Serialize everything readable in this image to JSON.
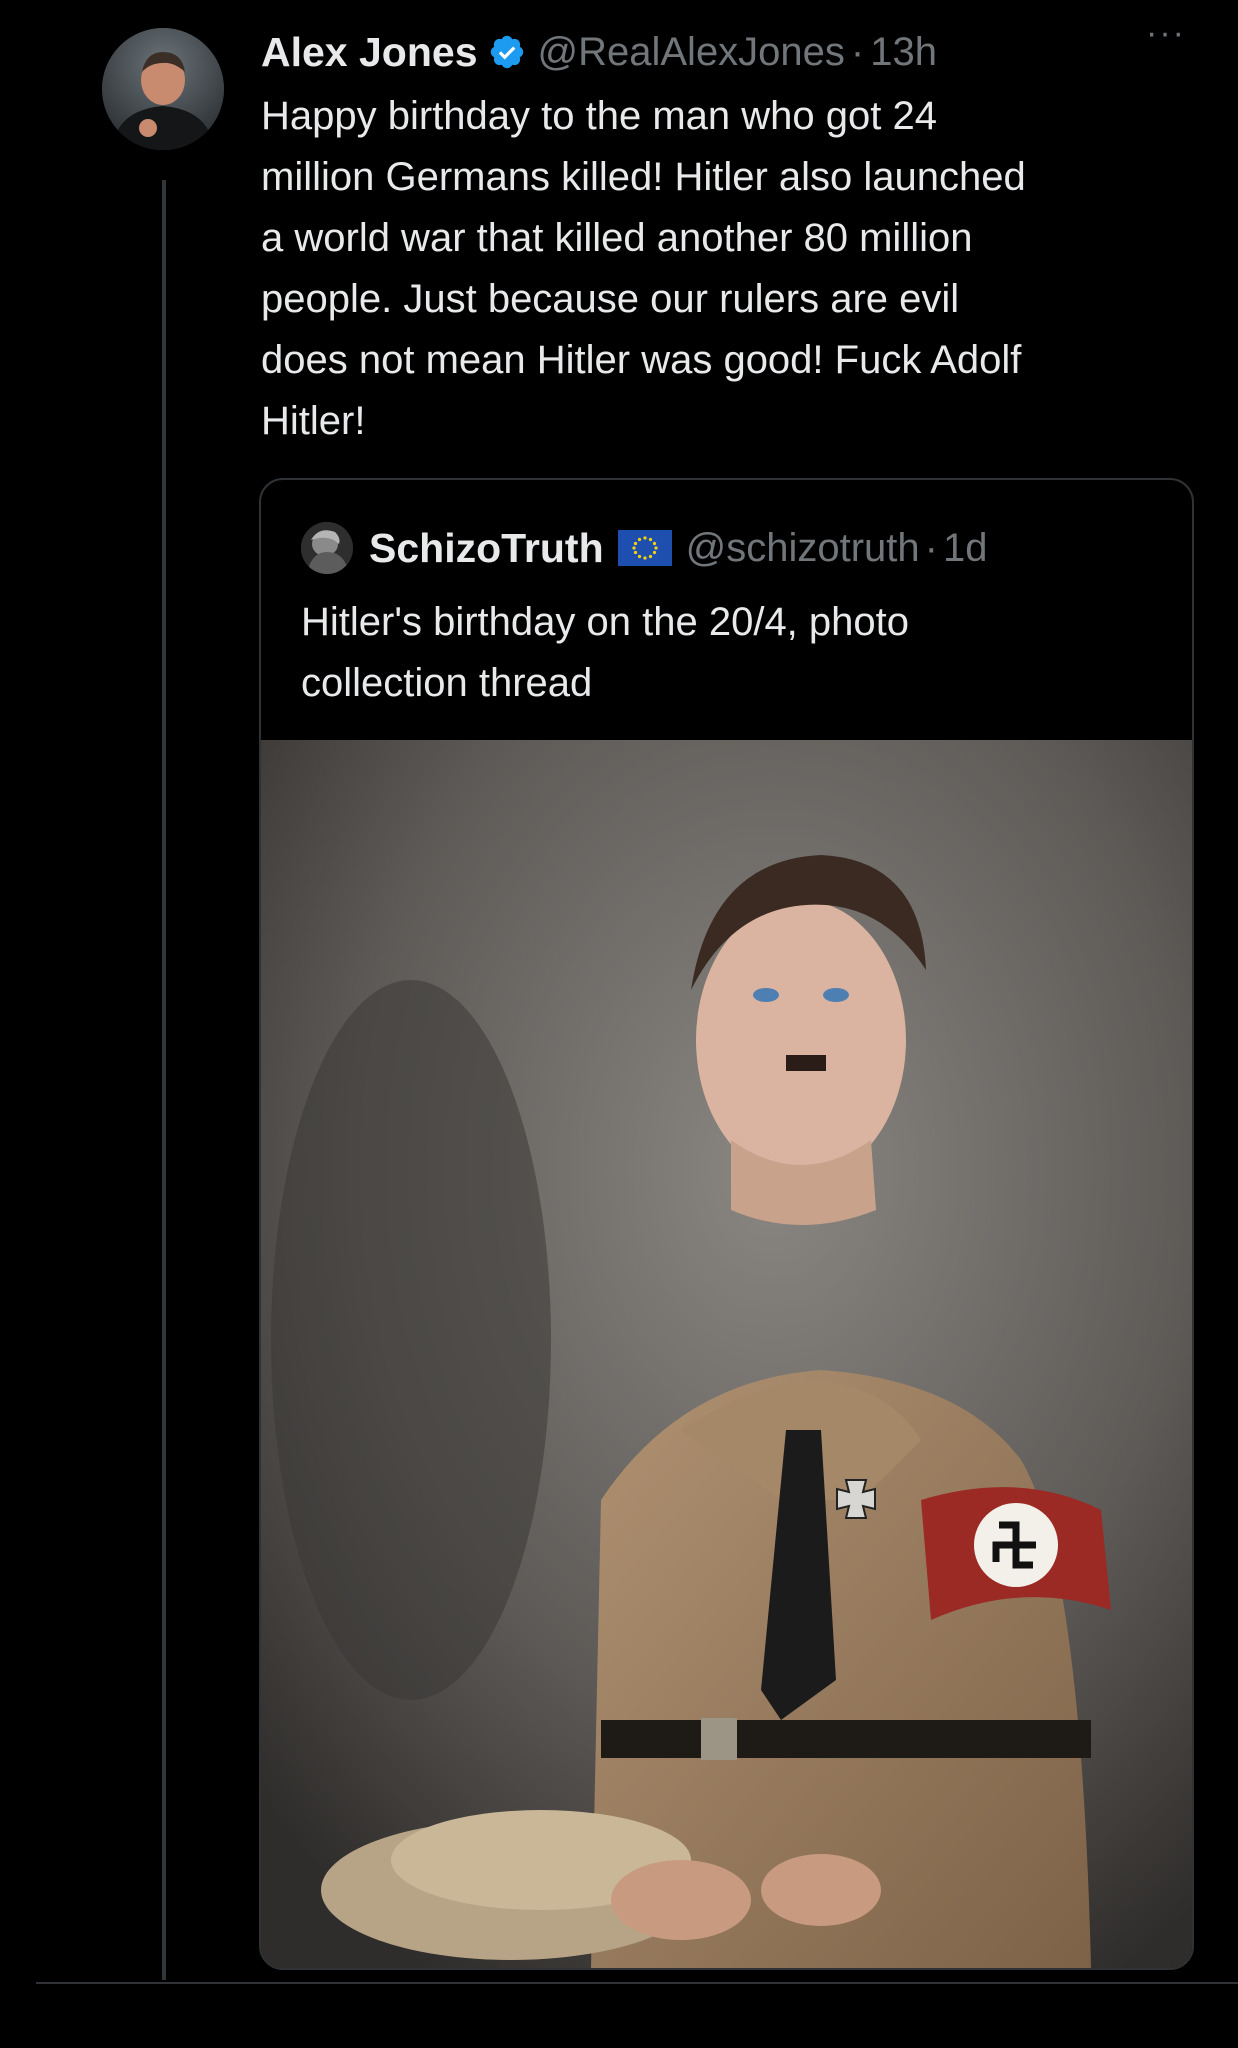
{
  "tweet": {
    "author": {
      "display_name": "Alex Jones",
      "handle": "@RealAlexJones",
      "verified_icon": "verified-badge-icon"
    },
    "separator": "·",
    "time": "13h",
    "more_label": "···",
    "text": "Happy birthday to the man who got 24\nmillion Germans killed! Hitler also launched\na world war that killed another 80 million\npeople. Just because our rulers are evil\ndoes not mean Hitler was good! Fuck Adolf\nHitler!",
    "quoted": {
      "author": {
        "display_name": "SchizoTruth",
        "handle": "@schizotruth",
        "flag_icon": "eu-flag-icon"
      },
      "separator": "·",
      "time": "1d",
      "text": "Hitler's birthday on the 20/4, photo\ncollection thread",
      "media_icon": "historical-portrait-photo"
    }
  },
  "colors": {
    "background": "#000000",
    "text_primary": "#e7e9ea",
    "text_secondary": "#71767b",
    "border": "#2f3336",
    "verified_blue": "#1d9bf0"
  }
}
